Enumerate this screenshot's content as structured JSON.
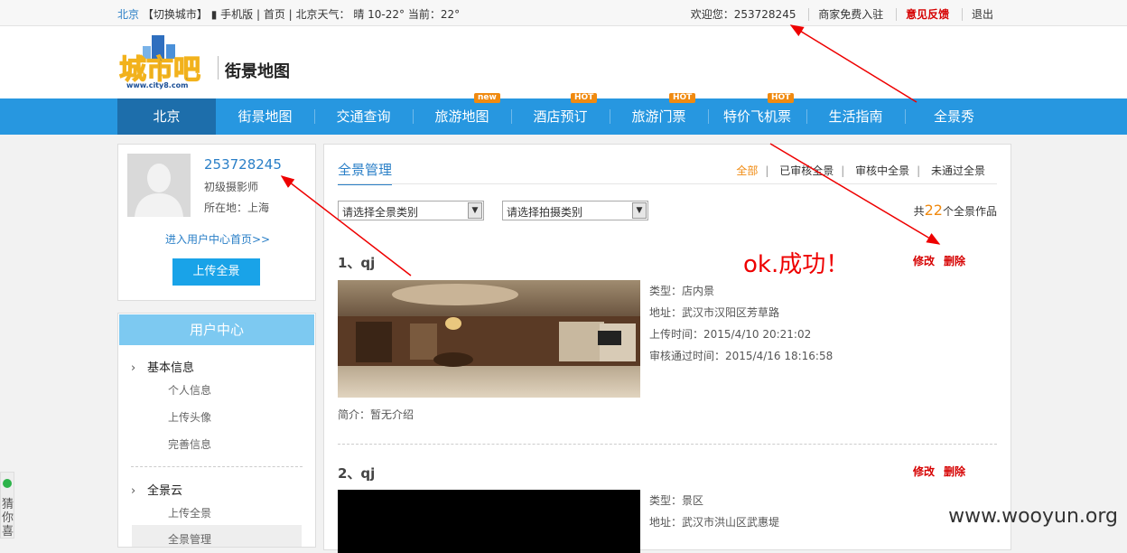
{
  "topbar": {
    "city": "北京",
    "switch_city": "【切换城市】",
    "mobile": "手机版",
    "home": "首页",
    "weather_label": "北京天气：",
    "weather": "晴  10-22°  当前：22°",
    "welcome": "欢迎您：253728245",
    "merchant": "商家免费入驻",
    "feedback": "意见反馈",
    "logout": "退出"
  },
  "header": {
    "logo_text": "城市吧",
    "logo_url": "www.city8.com",
    "subtitle": "街景地图"
  },
  "nav": {
    "items": [
      {
        "label": "北京",
        "badge": ""
      },
      {
        "label": "街景地图",
        "badge": ""
      },
      {
        "label": "交通查询",
        "badge": ""
      },
      {
        "label": "旅游地图",
        "badge": "new"
      },
      {
        "label": "酒店预订",
        "badge": "HOT"
      },
      {
        "label": "旅游门票",
        "badge": "HOT"
      },
      {
        "label": "特价飞机票",
        "badge": "HOT"
      },
      {
        "label": "生活指南",
        "badge": ""
      },
      {
        "label": "全景秀",
        "badge": ""
      }
    ]
  },
  "profile": {
    "username": "253728245",
    "rank": "初级摄影师",
    "location": "所在地：上海",
    "center_link": "进入用户中心首页>>",
    "upload": "上传全景"
  },
  "menu": {
    "title": "用户中心",
    "sec1": "基本信息",
    "sec1_items": [
      "个人信息",
      "上传头像",
      "完善信息"
    ],
    "sec2": "全景云",
    "sec2_items": [
      "上传全景",
      "全景管理"
    ]
  },
  "main": {
    "tab": "全景管理",
    "filters": [
      "全部",
      "已审核全景",
      "审核中全景",
      "未通过全景"
    ],
    "select1": "请选择全景类别",
    "select2": "请选择拍摄类别",
    "total_prefix": "共",
    "total_count": "22",
    "total_suffix": "个全景作品",
    "edit": "修改",
    "delete": "删除",
    "entries": [
      {
        "title": "1、qj",
        "type": "类型：店内景",
        "addr": "地址：武汉市汉阳区芳草路",
        "upload_time": "上传时间：2015/4/10 20:21:02",
        "audit_time": "审核通过时间：2015/4/16 18:16:58",
        "intro": "简介：暂无介绍"
      },
      {
        "title": "2、qj",
        "type": "类型：景区",
        "addr": "地址：武汉市洪山区武惠堤"
      }
    ]
  },
  "annotation": "ok.成功！",
  "guess": "猜你喜",
  "watermark": "www.wooyun.org",
  "colors": {
    "nav": "#2797e0",
    "nav_active": "#1d6eab",
    "accent": "#f08a10",
    "danger": "#d60000"
  }
}
